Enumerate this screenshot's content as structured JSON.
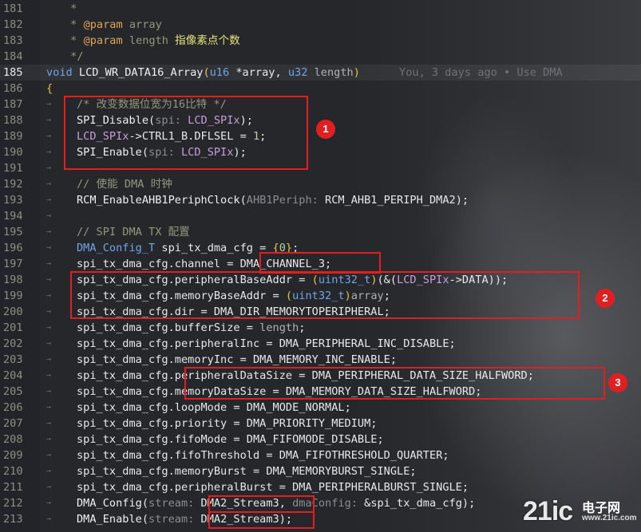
{
  "editor": {
    "lines": [
      {
        "n": "181",
        "parts": [
          [
            "ind2",
            ""
          ],
          [
            "c-com",
            " *"
          ]
        ]
      },
      {
        "n": "182",
        "parts": [
          [
            "ind2",
            ""
          ],
          [
            "c-com",
            " * "
          ],
          [
            "c-ann",
            "@param"
          ],
          [
            "c-com",
            " array"
          ]
        ]
      },
      {
        "n": "183",
        "parts": [
          [
            "ind2",
            ""
          ],
          [
            "c-com",
            " * "
          ],
          [
            "c-ann",
            "@param"
          ],
          [
            "c-com",
            " length "
          ],
          [
            "c-yel",
            "指像素点个数"
          ]
        ]
      },
      {
        "n": "184",
        "parts": [
          [
            "ind2",
            ""
          ],
          [
            "c-com",
            " */"
          ]
        ]
      },
      {
        "n": "185",
        "cur": true,
        "parts": [
          [
            "c-kw",
            "void"
          ],
          [
            "c-fn",
            " LCD_WR_DATA16_Array"
          ],
          [
            "bracket",
            "("
          ],
          [
            "c-typ",
            "u16"
          ],
          [
            "c-var",
            " *array, "
          ],
          [
            "c-typ",
            "u32"
          ],
          [
            "c-param",
            " length"
          ],
          [
            "bracket",
            ")"
          ],
          [
            "c-blame",
            "      You, 3 days ago • Use DMA"
          ]
        ]
      },
      {
        "n": "186",
        "parts": [
          [
            "bracket",
            "{"
          ]
        ]
      },
      {
        "n": "187",
        "parts": [
          [
            "ind",
            "→"
          ],
          [
            "ind2",
            ""
          ],
          [
            "c-com",
            "/* 改变数据位宽为16比特 */"
          ]
        ]
      },
      {
        "n": "188",
        "parts": [
          [
            "ind",
            "→"
          ],
          [
            "ind2",
            ""
          ],
          [
            "c-fn",
            "SPI_Disable"
          ],
          [
            "c-var",
            "("
          ],
          [
            "c-hint",
            "spi: "
          ],
          [
            "c-mac",
            "LCD_SPIx"
          ],
          [
            "c-var",
            ");"
          ]
        ]
      },
      {
        "n": "189",
        "parts": [
          [
            "ind",
            "→"
          ],
          [
            "ind2",
            ""
          ],
          [
            "c-mac",
            "LCD_SPIx"
          ],
          [
            "c-var",
            "->CTRL1_B.DFLSEL = "
          ],
          [
            "c-num",
            "1"
          ],
          [
            "c-var",
            ";"
          ]
        ]
      },
      {
        "n": "190",
        "parts": [
          [
            "ind",
            "→"
          ],
          [
            "ind2",
            ""
          ],
          [
            "c-fn",
            "SPI_Enable"
          ],
          [
            "c-var",
            "("
          ],
          [
            "c-hint",
            "spi: "
          ],
          [
            "c-mac",
            "LCD_SPIx"
          ],
          [
            "c-var",
            ");"
          ]
        ]
      },
      {
        "n": "191",
        "parts": [
          [
            "ind",
            "→"
          ]
        ]
      },
      {
        "n": "192",
        "parts": [
          [
            "ind",
            "→"
          ],
          [
            "ind2",
            ""
          ],
          [
            "c-com",
            "// 使能 DMA 时钟"
          ]
        ]
      },
      {
        "n": "193",
        "parts": [
          [
            "ind",
            "→"
          ],
          [
            "ind2",
            ""
          ],
          [
            "c-fn",
            "RCM_EnableAHB1PeriphClock"
          ],
          [
            "c-var",
            "("
          ],
          [
            "c-hint",
            "AHB1Periph: "
          ],
          [
            "c-const",
            "RCM_AHB1_PERIPH_DMA2"
          ],
          [
            "c-var",
            ");"
          ]
        ]
      },
      {
        "n": "194",
        "parts": [
          [
            "ind",
            "→"
          ]
        ]
      },
      {
        "n": "195",
        "parts": [
          [
            "ind",
            "→"
          ],
          [
            "ind2",
            ""
          ],
          [
            "c-com",
            "// SPI DMA TX 配置"
          ]
        ]
      },
      {
        "n": "196",
        "parts": [
          [
            "ind",
            "→"
          ],
          [
            "ind2",
            ""
          ],
          [
            "c-typ",
            "DMA_Config_T"
          ],
          [
            "c-var",
            " spi_tx_dma_cfg = "
          ],
          [
            "bracket",
            "{"
          ],
          [
            "c-num",
            "0"
          ],
          [
            "bracket",
            "}"
          ],
          [
            "c-var",
            ";"
          ]
        ]
      },
      {
        "n": "197",
        "parts": [
          [
            "ind",
            "→"
          ],
          [
            "ind2",
            ""
          ],
          [
            "c-var",
            "spi_tx_dma_cfg.channel = "
          ],
          [
            "c-const",
            "DMA_CHANNEL_3"
          ],
          [
            "c-var",
            ";"
          ]
        ]
      },
      {
        "n": "198",
        "parts": [
          [
            "ind",
            "→"
          ],
          [
            "ind2",
            ""
          ],
          [
            "c-var",
            "spi_tx_dma_cfg.peripheralBaseAddr = "
          ],
          [
            "bracket",
            "("
          ],
          [
            "c-typ",
            "uint32_t"
          ],
          [
            "bracket",
            ")"
          ],
          [
            "c-var",
            "(&("
          ],
          [
            "c-mac",
            "LCD_SPIx"
          ],
          [
            "c-var",
            "->DATA));"
          ]
        ]
      },
      {
        "n": "199",
        "parts": [
          [
            "ind",
            "→"
          ],
          [
            "ind2",
            ""
          ],
          [
            "c-var",
            "spi_tx_dma_cfg.memoryBaseAddr = "
          ],
          [
            "bracket",
            "("
          ],
          [
            "c-typ",
            "uint32_t"
          ],
          [
            "bracket",
            ")"
          ],
          [
            "c-param",
            "array"
          ],
          [
            "c-var",
            ";"
          ]
        ]
      },
      {
        "n": "200",
        "parts": [
          [
            "ind",
            "→"
          ],
          [
            "ind2",
            ""
          ],
          [
            "c-var",
            "spi_tx_dma_cfg.dir = "
          ],
          [
            "c-const",
            "DMA_DIR_MEMORYTOPERIPHERAL"
          ],
          [
            "c-var",
            ";"
          ]
        ]
      },
      {
        "n": "201",
        "parts": [
          [
            "ind",
            "→"
          ],
          [
            "ind2",
            ""
          ],
          [
            "c-var",
            "spi_tx_dma_cfg.bufferSize = "
          ],
          [
            "c-param",
            "length"
          ],
          [
            "c-var",
            ";"
          ]
        ]
      },
      {
        "n": "202",
        "parts": [
          [
            "ind",
            "→"
          ],
          [
            "ind2",
            ""
          ],
          [
            "c-var",
            "spi_tx_dma_cfg.peripheralInc = "
          ],
          [
            "c-const",
            "DMA_PERIPHERAL_INC_DISABLE"
          ],
          [
            "c-var",
            ";"
          ]
        ]
      },
      {
        "n": "203",
        "parts": [
          [
            "ind",
            "→"
          ],
          [
            "ind2",
            ""
          ],
          [
            "c-var",
            "spi_tx_dma_cfg.memoryInc = "
          ],
          [
            "c-const",
            "DMA_MEMORY_INC_ENABLE"
          ],
          [
            "c-var",
            ";"
          ]
        ]
      },
      {
        "n": "204",
        "parts": [
          [
            "ind",
            "→"
          ],
          [
            "ind2",
            ""
          ],
          [
            "c-var",
            "spi_tx_dma_cfg.peripheralDataSize = "
          ],
          [
            "c-const",
            "DMA_PERIPHERAL_DATA_SIZE_HALFWORD"
          ],
          [
            "c-var",
            ";"
          ]
        ]
      },
      {
        "n": "205",
        "parts": [
          [
            "ind",
            "→"
          ],
          [
            "ind2",
            ""
          ],
          [
            "c-var",
            "spi_tx_dma_cfg.memoryDataSize = "
          ],
          [
            "c-const",
            "DMA_MEMORY_DATA_SIZE_HALFWORD"
          ],
          [
            "c-var",
            ";"
          ]
        ]
      },
      {
        "n": "206",
        "parts": [
          [
            "ind",
            "→"
          ],
          [
            "ind2",
            ""
          ],
          [
            "c-var",
            "spi_tx_dma_cfg.loopMode = "
          ],
          [
            "c-const",
            "DMA_MODE_NORMAL"
          ],
          [
            "c-var",
            ";"
          ]
        ]
      },
      {
        "n": "207",
        "parts": [
          [
            "ind",
            "→"
          ],
          [
            "ind2",
            ""
          ],
          [
            "c-var",
            "spi_tx_dma_cfg.priority = "
          ],
          [
            "c-const",
            "DMA_PRIORITY_MEDIUM"
          ],
          [
            "c-var",
            ";"
          ]
        ]
      },
      {
        "n": "208",
        "parts": [
          [
            "ind",
            "→"
          ],
          [
            "ind2",
            ""
          ],
          [
            "c-var",
            "spi_tx_dma_cfg.fifoMode = "
          ],
          [
            "c-const",
            "DMA_FIFOMODE_DISABLE"
          ],
          [
            "c-var",
            ";"
          ]
        ]
      },
      {
        "n": "209",
        "parts": [
          [
            "ind",
            "→"
          ],
          [
            "ind2",
            ""
          ],
          [
            "c-var",
            "spi_tx_dma_cfg.fifoThreshold = "
          ],
          [
            "c-const",
            "DMA_FIFOTHRESHOLD_QUARTER"
          ],
          [
            "c-var",
            ";"
          ]
        ]
      },
      {
        "n": "210",
        "parts": [
          [
            "ind",
            "→"
          ],
          [
            "ind2",
            ""
          ],
          [
            "c-var",
            "spi_tx_dma_cfg.memoryBurst = "
          ],
          [
            "c-const",
            "DMA_MEMORYBURST_SINGLE"
          ],
          [
            "c-var",
            ";"
          ]
        ]
      },
      {
        "n": "211",
        "parts": [
          [
            "ind",
            "→"
          ],
          [
            "ind2",
            ""
          ],
          [
            "c-var",
            "spi_tx_dma_cfg.peripheralBurst = "
          ],
          [
            "c-const",
            "DMA_PERIPHERALBURST_SINGLE"
          ],
          [
            "c-var",
            ";"
          ]
        ]
      },
      {
        "n": "212",
        "parts": [
          [
            "ind",
            "→"
          ],
          [
            "ind2",
            ""
          ],
          [
            "c-fn",
            "DMA_Config"
          ],
          [
            "c-var",
            "("
          ],
          [
            "c-hint",
            "stream: "
          ],
          [
            "c-const",
            "DMA2_Stream3"
          ],
          [
            "c-var",
            ", "
          ],
          [
            "c-hint",
            "dmaConfig: "
          ],
          [
            "c-var",
            "&spi_tx_dma_cfg);"
          ]
        ]
      },
      {
        "n": "213",
        "parts": [
          [
            "ind",
            "→"
          ],
          [
            "ind2",
            ""
          ],
          [
            "c-fn",
            "DMA_Enable"
          ],
          [
            "c-var",
            "("
          ],
          [
            "c-hint",
            "stream: "
          ],
          [
            "c-const",
            "DMA2_Stream3"
          ],
          [
            "c-var",
            ");"
          ]
        ]
      }
    ]
  },
  "annotations": {
    "badge1": "1",
    "badge2": "2",
    "badge3": "3"
  },
  "watermark": {
    "main": "21ic",
    "cn": "电子网",
    "url": "www.21ic.com"
  }
}
